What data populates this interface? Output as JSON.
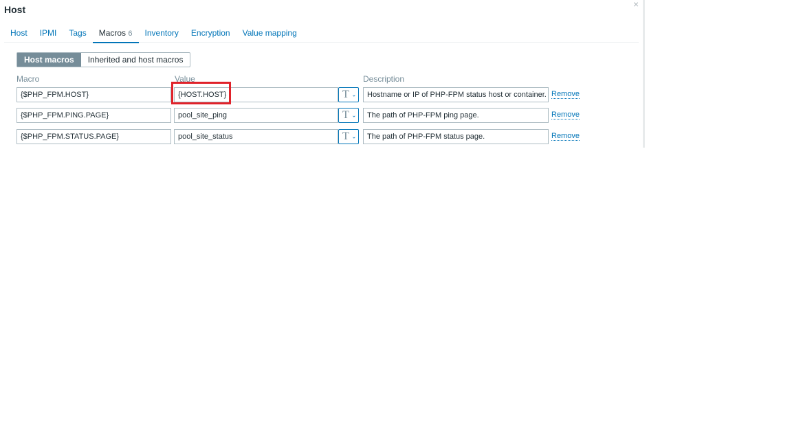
{
  "title": "Host",
  "tabs": [
    {
      "label": "Host"
    },
    {
      "label": "IPMI"
    },
    {
      "label": "Tags"
    },
    {
      "label": "Macros",
      "count": "6"
    },
    {
      "label": "Inventory"
    },
    {
      "label": "Encryption"
    },
    {
      "label": "Value mapping"
    }
  ],
  "subtabs": [
    "Host macros",
    "Inherited and host macros"
  ],
  "headers": {
    "macro": "Macro",
    "value": "Value",
    "description": "Description"
  },
  "rows": [
    {
      "macro": "{$PHP_FPM.HOST}",
      "value": "{HOST.HOST}",
      "type": "T",
      "description": "Hostname or IP of PHP-FPM status host or container.",
      "remove": "Remove"
    },
    {
      "macro": "{$PHP_FPM.PING.PAGE}",
      "value": "pool_site_ping",
      "type": "T",
      "description": "The path of PHP-FPM ping page.",
      "remove": "Remove"
    },
    {
      "macro": "{$PHP_FPM.STATUS.PAGE}",
      "value": "pool_site_status",
      "type": "T",
      "description": "The path of PHP-FPM status page.",
      "remove": "Remove"
    }
  ],
  "close": "×"
}
